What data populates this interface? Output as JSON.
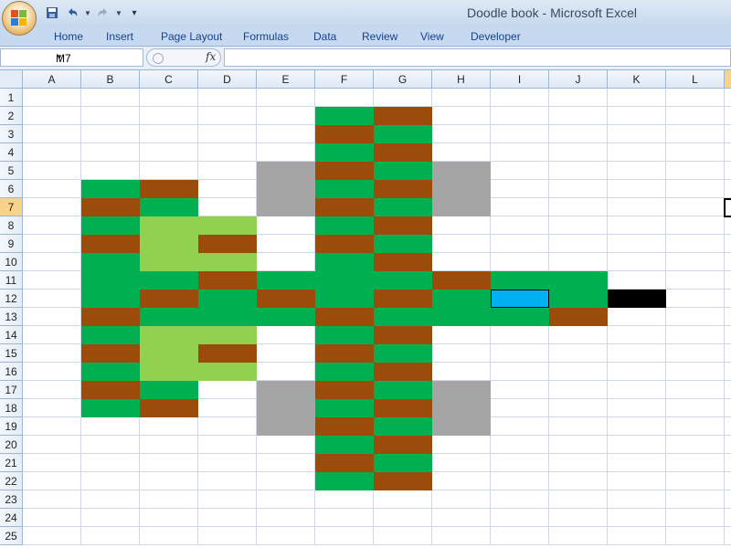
{
  "window": {
    "title": "Doodle book - Microsoft Excel"
  },
  "ribbon": {
    "tabs": [
      "Home",
      "Insert",
      "Page Layout",
      "Formulas",
      "Data",
      "Review",
      "View",
      "Developer"
    ]
  },
  "formula_bar": {
    "name_box": "M7",
    "fx_label": "fx",
    "formula": ""
  },
  "sheet": {
    "columns": [
      "A",
      "B",
      "C",
      "D",
      "E",
      "F",
      "G",
      "H",
      "I",
      "J",
      "K",
      "L"
    ],
    "rows": [
      "1",
      "2",
      "3",
      "4",
      "5",
      "6",
      "7",
      "8",
      "9",
      "10",
      "11",
      "12",
      "13",
      "14",
      "15",
      "16",
      "17",
      "18",
      "19",
      "20",
      "21",
      "22",
      "23",
      "24",
      "25"
    ],
    "selected_cell": "M7",
    "fill_colors": {
      "green": "#00b050",
      "brown": "#9b4b0a",
      "light_green": "#92d050",
      "gray": "#a5a5a5",
      "blue": "#00b0f0",
      "black": "#000000"
    },
    "fills": [
      [
        "F2",
        "green"
      ],
      [
        "G2",
        "brown"
      ],
      [
        "F3",
        "brown"
      ],
      [
        "G3",
        "green"
      ],
      [
        "F4",
        "green"
      ],
      [
        "G4",
        "brown"
      ],
      [
        "E5",
        "gray"
      ],
      [
        "F5",
        "brown"
      ],
      [
        "G5",
        "green"
      ],
      [
        "H5",
        "gray"
      ],
      [
        "B6",
        "green"
      ],
      [
        "C6",
        "brown"
      ],
      [
        "E6",
        "gray"
      ],
      [
        "F6",
        "green"
      ],
      [
        "G6",
        "brown"
      ],
      [
        "H6",
        "gray"
      ],
      [
        "B7",
        "brown"
      ],
      [
        "C7",
        "green"
      ],
      [
        "E7",
        "gray"
      ],
      [
        "F7",
        "brown"
      ],
      [
        "G7",
        "green"
      ],
      [
        "H7",
        "gray"
      ],
      [
        "B8",
        "green"
      ],
      [
        "C8",
        "light_green"
      ],
      [
        "D8",
        "light_green"
      ],
      [
        "F8",
        "green"
      ],
      [
        "G8",
        "brown"
      ],
      [
        "B9",
        "brown"
      ],
      [
        "C9",
        "light_green"
      ],
      [
        "D9",
        "brown"
      ],
      [
        "F9",
        "brown"
      ],
      [
        "G9",
        "green"
      ],
      [
        "B10",
        "green"
      ],
      [
        "C10",
        "light_green"
      ],
      [
        "D10",
        "light_green"
      ],
      [
        "F10",
        "green"
      ],
      [
        "G10",
        "brown"
      ],
      [
        "B11",
        "green"
      ],
      [
        "C11",
        "green"
      ],
      [
        "D11",
        "brown"
      ],
      [
        "E11",
        "green"
      ],
      [
        "F11",
        "green"
      ],
      [
        "G11",
        "green"
      ],
      [
        "H11",
        "brown"
      ],
      [
        "I11",
        "green"
      ],
      [
        "J11",
        "green"
      ],
      [
        "B12",
        "green"
      ],
      [
        "C12",
        "brown"
      ],
      [
        "D12",
        "green"
      ],
      [
        "E12",
        "brown"
      ],
      [
        "F12",
        "green"
      ],
      [
        "G12",
        "brown"
      ],
      [
        "H12",
        "green"
      ],
      [
        "I12",
        "blue"
      ],
      [
        "J12",
        "green"
      ],
      [
        "K12",
        "black"
      ],
      [
        "B13",
        "brown"
      ],
      [
        "C13",
        "green"
      ],
      [
        "D13",
        "green"
      ],
      [
        "E13",
        "green"
      ],
      [
        "F13",
        "brown"
      ],
      [
        "G13",
        "green"
      ],
      [
        "H13",
        "green"
      ],
      [
        "I13",
        "green"
      ],
      [
        "J13",
        "brown"
      ],
      [
        "B14",
        "green"
      ],
      [
        "C14",
        "light_green"
      ],
      [
        "D14",
        "light_green"
      ],
      [
        "F14",
        "green"
      ],
      [
        "G14",
        "brown"
      ],
      [
        "B15",
        "brown"
      ],
      [
        "C15",
        "light_green"
      ],
      [
        "D15",
        "brown"
      ],
      [
        "F15",
        "brown"
      ],
      [
        "G15",
        "green"
      ],
      [
        "B16",
        "green"
      ],
      [
        "C16",
        "light_green"
      ],
      [
        "D16",
        "light_green"
      ],
      [
        "F16",
        "green"
      ],
      [
        "G16",
        "brown"
      ],
      [
        "B17",
        "brown"
      ],
      [
        "C17",
        "green"
      ],
      [
        "E17",
        "gray"
      ],
      [
        "F17",
        "brown"
      ],
      [
        "G17",
        "green"
      ],
      [
        "H17",
        "gray"
      ],
      [
        "B18",
        "green"
      ],
      [
        "C18",
        "brown"
      ],
      [
        "E18",
        "gray"
      ],
      [
        "F18",
        "green"
      ],
      [
        "G18",
        "brown"
      ],
      [
        "H18",
        "gray"
      ],
      [
        "E19",
        "gray"
      ],
      [
        "F19",
        "brown"
      ],
      [
        "G19",
        "green"
      ],
      [
        "H19",
        "gray"
      ],
      [
        "F20",
        "green"
      ],
      [
        "G20",
        "brown"
      ],
      [
        "F21",
        "brown"
      ],
      [
        "G21",
        "green"
      ],
      [
        "F22",
        "green"
      ],
      [
        "G22",
        "brown"
      ]
    ]
  }
}
